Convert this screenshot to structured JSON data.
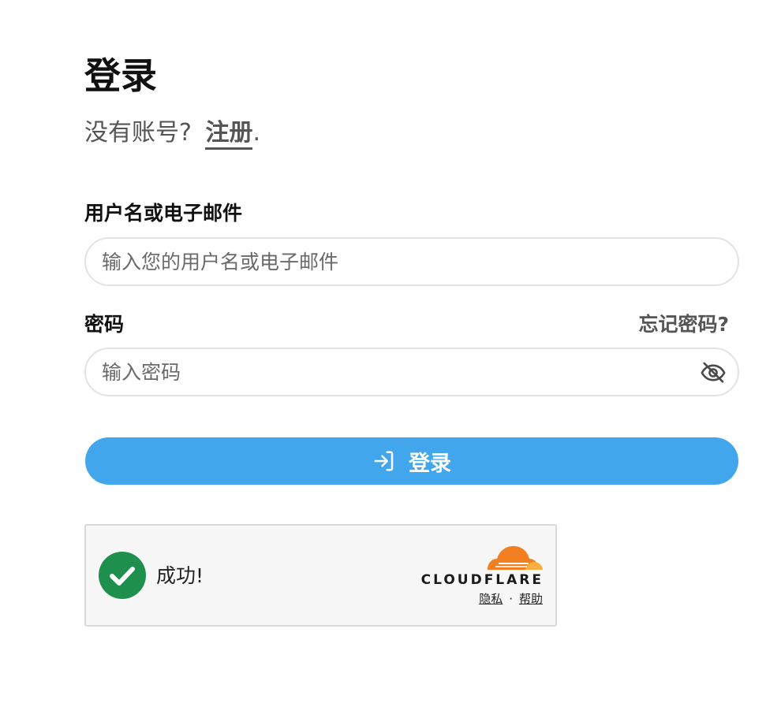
{
  "page": {
    "title": "登录",
    "no_account_text": "没有账号?",
    "signup_link": "注册",
    "signup_suffix": "."
  },
  "form": {
    "username_label": "用户名或电子邮件",
    "username_placeholder": "输入您的用户名或电子邮件",
    "username_value": "",
    "password_label": "密码",
    "forgot_password": "忘记密码?",
    "password_placeholder": "输入密码",
    "password_value": "",
    "password_toggle_icon": "eye-slash-icon",
    "submit_label": "登录",
    "submit_icon": "sign-in-icon"
  },
  "captcha": {
    "status": "成功!",
    "status_icon": "check-circle-icon",
    "provider": "CLOUDFLARE",
    "privacy_link": "隐私",
    "separator": "·",
    "help_link": "帮助"
  },
  "colors": {
    "accent": "#41a6ec",
    "success": "#1f8f4e",
    "cloudflare_orange": "#f38020",
    "cloudflare_light_orange": "#faae40"
  }
}
